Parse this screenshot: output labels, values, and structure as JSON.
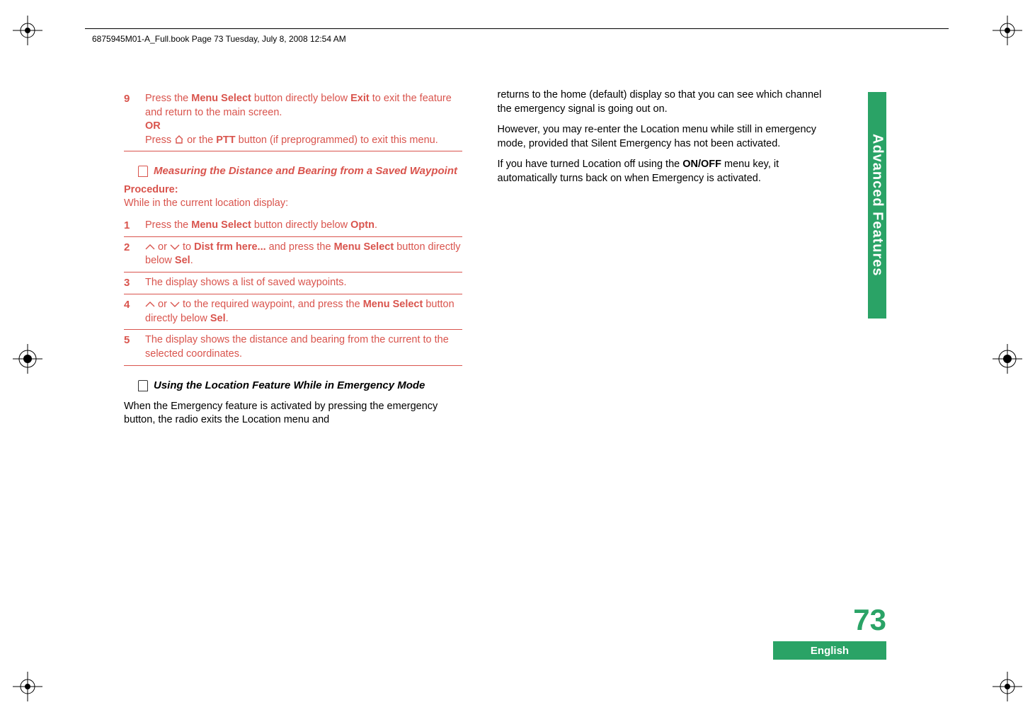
{
  "header": {
    "running": "6875945M01-A_Full.book  Page 73  Tuesday, July 8, 2008  12:54 AM"
  },
  "left": {
    "step9": {
      "num": "9",
      "l1a": "Press the ",
      "l1b": "Menu Select",
      "l1c": " button directly below ",
      "l1d": "Exit",
      "l1e": " to exit the feature and return to the main screen.",
      "or": "OR",
      "l2a": "Press ",
      "l2b": " or the ",
      "l2c": "PTT",
      "l2d": " button (if preprogrammed) to exit this menu."
    },
    "h1": "Measuring the Distance and Bearing from a Saved Waypoint",
    "proc": "Procedure:",
    "procDesc": "While in the current location display:",
    "s1": {
      "num": "1",
      "a": "Press the ",
      "b": "Menu Select",
      "c": " button directly below ",
      "d": "Optn",
      "e": "."
    },
    "s2": {
      "num": "2",
      "a": " or ",
      "b": " to ",
      "c": "Dist frm here...",
      "d": " and press the ",
      "e": "Menu Select",
      "f": " button directly below ",
      "g": "Sel",
      "h": "."
    },
    "s3": {
      "num": "3",
      "a": "The display shows a list of saved waypoints."
    },
    "s4": {
      "num": "4",
      "a": " or ",
      "b": " to the required waypoint, and press the ",
      "c": "Menu Select",
      "d": " button directly below ",
      "e": "Sel",
      "f": "."
    },
    "s5": {
      "num": "5",
      "a": "The display shows the distance and bearing from the current to the selected coordinates."
    },
    "h2": "Using the Location Feature While in Emergency Mode",
    "p1": "When the Emergency feature is activated by pressing the emergency button, the radio exits the Location menu and "
  },
  "right": {
    "p1": "returns to the home (default) display so that you can see which channel the emergency signal is going out on.",
    "p2": "However, you may re-enter the Location menu while still in emergency mode, provided that Silent Emergency has not been activated.",
    "p3a": "If you have turned Location off using the ",
    "p3b": "ON/OFF",
    "p3c": " menu key, it automatically turns back on when Emergency is activated."
  },
  "side": {
    "tab": "Advanced Features",
    "pagenum": "73",
    "lang": "English"
  },
  "chart_data": null
}
